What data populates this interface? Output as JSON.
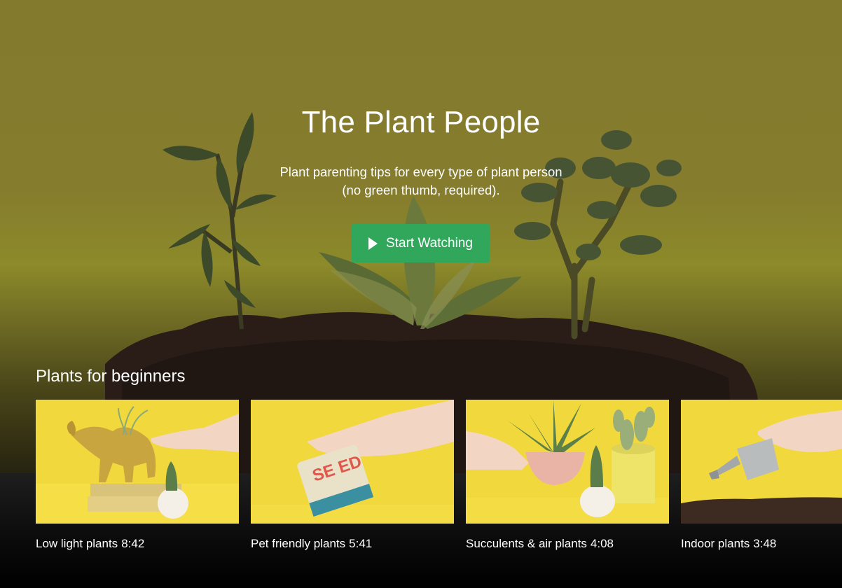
{
  "hero": {
    "title": "The Plant People",
    "subtitle_line1": "Plant parenting tips for every type of plant person",
    "subtitle_line2": "(no green thumb, required).",
    "cta_label": "Start Watching",
    "cta_icon": "play-icon",
    "cta_color": "#31a75b"
  },
  "section": {
    "title": "Plants for beginners",
    "videos": [
      {
        "title": "Low light plants",
        "duration": "8:42"
      },
      {
        "title": "Pet friendly plants",
        "duration": "5:41"
      },
      {
        "title": "Succulents & air plants",
        "duration": "4:08"
      },
      {
        "title": "Indoor plants",
        "duration": "3:48"
      }
    ]
  },
  "thumb_seed_packet_text": "SE ED"
}
